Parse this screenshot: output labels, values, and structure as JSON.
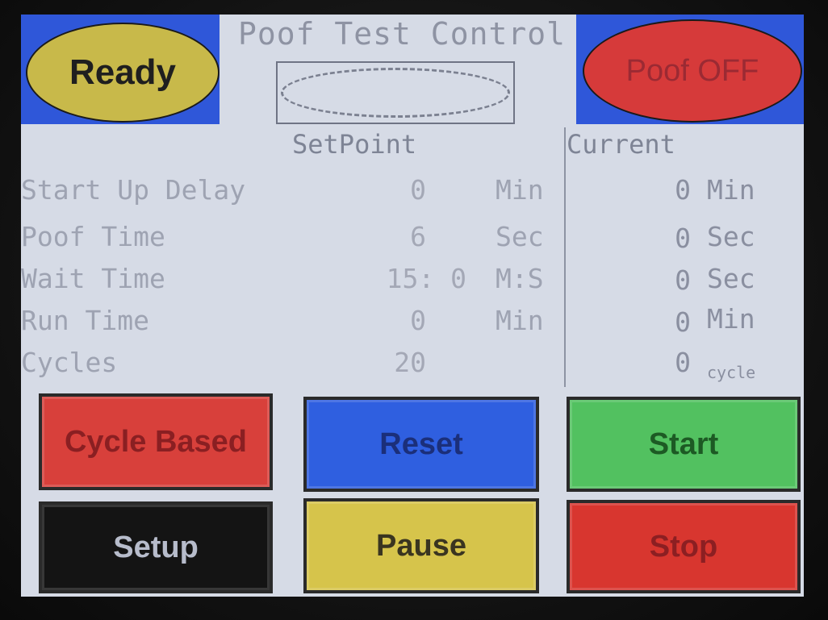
{
  "header": {
    "title": "Poof Test Control",
    "status_left": "Ready",
    "status_right": "Poof OFF"
  },
  "columns": {
    "setpoint": "SetPoint",
    "current": "Current"
  },
  "rows": [
    {
      "label": "Start Up Delay",
      "setpoint": "0",
      "unit": "Min",
      "current": "0",
      "current_unit": "Min"
    },
    {
      "label": "Poof Time",
      "setpoint": "6",
      "unit": "Sec",
      "current": "0",
      "current_unit": "Sec"
    },
    {
      "label": "Wait Time",
      "setpoint": "15:  0",
      "unit": "M:S",
      "current": "0",
      "current_unit": "Sec"
    },
    {
      "label": "Run Time",
      "setpoint": "0",
      "unit": "Min",
      "current": "0",
      "current_unit": "Min"
    },
    {
      "label": "Cycles",
      "setpoint": "20",
      "unit": "",
      "current": "0",
      "current_unit": "cycle"
    }
  ],
  "buttons": {
    "cycle_based": "Cycle Based",
    "reset": "Reset",
    "start": "Start",
    "setup": "Setup",
    "pause": "Pause",
    "stop": "Stop"
  },
  "colors": {
    "panel_bg": "#d6dbe6",
    "header_blue": "#2f57d9",
    "ready_yellow": "#c8b94a",
    "poof_red": "#d63a3a",
    "reset_blue": "#2f5fe0",
    "start_green": "#52c160",
    "pause_yellow": "#d6c44b",
    "stop_red": "#d8362f",
    "setup_black": "#141414"
  }
}
